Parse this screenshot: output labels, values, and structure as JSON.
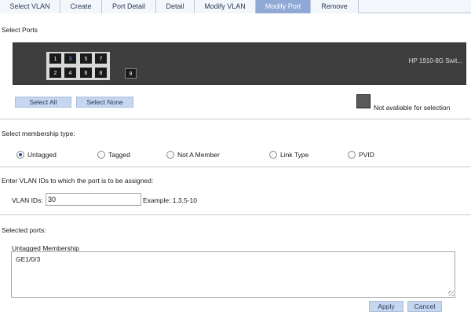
{
  "tabs": [
    {
      "label": "Select VLAN",
      "active": false
    },
    {
      "label": "Create",
      "active": false
    },
    {
      "label": "Port Detail",
      "active": false
    },
    {
      "label": "Detail",
      "active": false
    },
    {
      "label": "Modify VLAN",
      "active": false
    },
    {
      "label": "Modify Port",
      "active": true
    },
    {
      "label": "Remove",
      "active": false
    }
  ],
  "select_ports": {
    "label": "Select Ports",
    "switch_name": "HP 1910-8G Swit...",
    "ports_top": [
      "1",
      "3",
      "5",
      "7"
    ],
    "ports_bottom": [
      "2",
      "4",
      "6",
      "8"
    ],
    "extra_port": "9",
    "selected_port": "3",
    "select_all": "Select All",
    "select_none": "Select None",
    "legend": "Not avaliable for selection"
  },
  "membership": {
    "label": "Select membership type:",
    "options": [
      "Untagged",
      "Tagged",
      "Not A Member",
      "Link Type",
      "PVID"
    ],
    "selected": "Untagged"
  },
  "vlan": {
    "label": "Enter VLAN IDs to which the port is to be assigned:",
    "field_label": "VLAN IDs:",
    "value": "30",
    "example": "Example: 1,3,5-10"
  },
  "selected_ports": {
    "label": "Selected ports:",
    "group_label": "Untagged Membership",
    "content": "GE1/0/3"
  },
  "actions": {
    "apply": "Apply",
    "cancel": "Cancel"
  },
  "colors": {
    "active_tab": "#8fa8d6",
    "button": "#c6d6ef",
    "switch_body": "#3e3e3e"
  }
}
